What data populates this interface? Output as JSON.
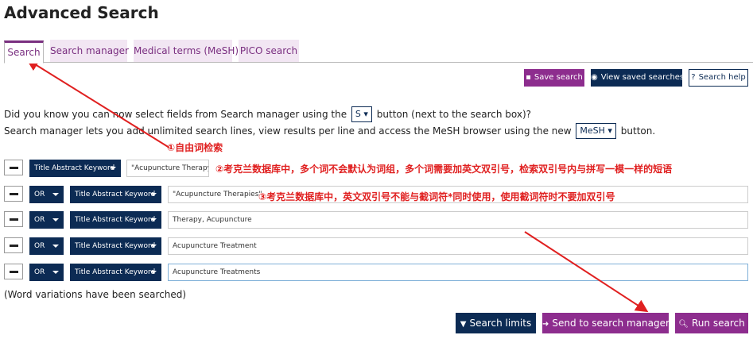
{
  "page_title": "Advanced Search",
  "tabs": [
    {
      "label": "Search",
      "active": true
    },
    {
      "label": "Search manager"
    },
    {
      "label": "Medical terms (MeSH)"
    },
    {
      "label": "PICO search"
    }
  ],
  "toolbar": {
    "save_label": "Save search",
    "view_saved_label": "View saved searches",
    "help_label": "Search help"
  },
  "info": {
    "line1_before": "Did you know you can now select fields from Search manager using the",
    "line1_button": "S",
    "line1_after": "button (next to the search box)?",
    "line2_before": "Search manager lets you add unlimited search lines, view results per line and access the MeSH browser using the new",
    "line2_button": "MeSH",
    "line2_after": "button."
  },
  "rows": [
    {
      "field": "Title Abstract Keyword",
      "query": "\"Acupuncture Therapy\""
    },
    {
      "operator": "OR",
      "field": "Title Abstract Keyword",
      "query": "\"Acupuncture Therapies\""
    },
    {
      "operator": "OR",
      "field": "Title Abstract Keyword",
      "query": "Therapy, Acupuncture"
    },
    {
      "operator": "OR",
      "field": "Title Abstract Keyword",
      "query": "Acupuncture Treatment"
    },
    {
      "operator": "OR",
      "field": "Title Abstract Keyword",
      "query": "Acupuncture Treatments"
    }
  ],
  "variations_note": "(Word variations have been searched)",
  "actions": {
    "limits_label": "Search limits",
    "send_label": "Send to search manager",
    "run_label": "Run search"
  },
  "annotations": {
    "a1": "①自由词检索",
    "a2": "②考克兰数据库中，多个词不会默认为词组，多个词需要加英文双引号，检索双引号内与拼写一模一样的短语",
    "a3": "③考克兰数据库中，英文双引号不能与截词符*同时使用，使用截词符时不要加双引号"
  },
  "colors": {
    "brand_purple": "#8d2d8e",
    "navy": "#0c2b54",
    "annotation_red": "#e02020"
  }
}
